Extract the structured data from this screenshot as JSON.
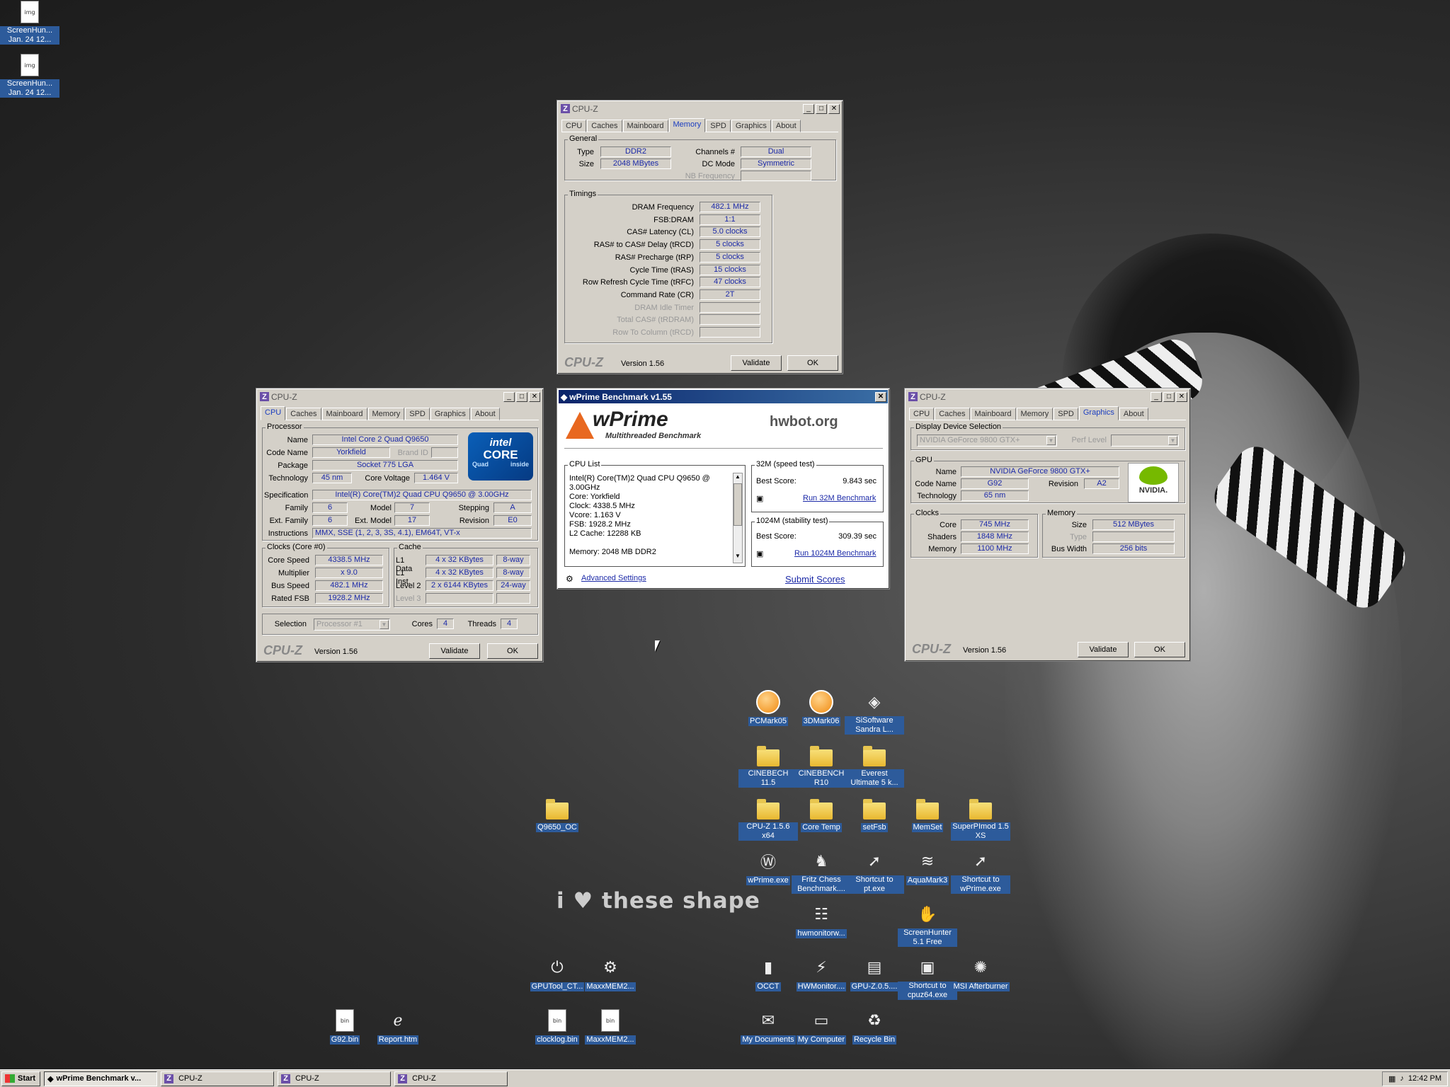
{
  "desktop": {
    "wallpaper_text": "i ♥ these shape",
    "icons": [
      {
        "label": "ScreenHun... Jan. 24 12...",
        "icon": "image-file-icon"
      },
      {
        "label": "ScreenHun... Jan. 24 12...",
        "icon": "image-file-icon"
      },
      {
        "label": "PCMark05",
        "icon": "pcmark-icon"
      },
      {
        "label": "3DMark06",
        "icon": "3dmark-icon"
      },
      {
        "label": "SiSoftware Sandra L...",
        "icon": "sandra-icon"
      },
      {
        "label": "CINEBECH 11.5",
        "icon": "folder-icon"
      },
      {
        "label": "CINEBENCH R10",
        "icon": "folder-icon"
      },
      {
        "label": "Everest Ultimate 5 k...",
        "icon": "folder-icon"
      },
      {
        "label": "Q9650_OC",
        "icon": "folder-icon"
      },
      {
        "label": "CPU-Z 1.5.6 x64",
        "icon": "folder-icon"
      },
      {
        "label": "Core Temp",
        "icon": "folder-icon"
      },
      {
        "label": "setFsb",
        "icon": "folder-icon"
      },
      {
        "label": "MemSet",
        "icon": "folder-icon"
      },
      {
        "label": "SuperPImod 1.5 XS",
        "icon": "folder-icon"
      },
      {
        "label": "wPrime.exe",
        "icon": "wprime-icon"
      },
      {
        "label": "Fritz Chess Benchmark....",
        "icon": "fritz-icon"
      },
      {
        "label": "Shortcut to pt.exe",
        "icon": "shortcut-icon"
      },
      {
        "label": "AquaMark3",
        "icon": "aquamark-icon"
      },
      {
        "label": "Shortcut to wPrime.exe",
        "icon": "shortcut-icon"
      },
      {
        "label": "hwmonitorw...",
        "icon": "hwmonitor-icon"
      },
      {
        "label": "ScreenHunter 5.1 Free",
        "icon": "screenhunter-icon"
      },
      {
        "label": "GPUTool_CT...",
        "icon": "power-icon"
      },
      {
        "label": "MaxxMEM2...",
        "icon": "gear-icon"
      },
      {
        "label": "OCCT",
        "icon": "occt-icon"
      },
      {
        "label": "HWMonitor....",
        "icon": "hwmonitor-bolt-icon"
      },
      {
        "label": "GPU-Z.0.5....",
        "icon": "gpuz-icon"
      },
      {
        "label": "Shortcut to cpuz64.exe",
        "icon": "cpuz-icon"
      },
      {
        "label": "MSI Afterburner",
        "icon": "afterburner-icon"
      },
      {
        "label": "G92.bin",
        "icon": "file-icon"
      },
      {
        "label": "Report.htm",
        "icon": "ie-icon"
      },
      {
        "label": "clocklog.bin",
        "icon": "file-icon"
      },
      {
        "label": "MaxxMEM2...",
        "icon": "file-icon"
      },
      {
        "label": "My Documents",
        "icon": "my-documents-icon"
      },
      {
        "label": "My Computer",
        "icon": "my-computer-icon"
      },
      {
        "label": "Recycle Bin",
        "icon": "recycle-bin-icon"
      }
    ]
  },
  "common": {
    "title": "CPU-Z",
    "version": "Version 1.56",
    "brand": "CPU-Z",
    "validate": "Validate",
    "ok": "OK",
    "tabs": [
      "CPU",
      "Caches",
      "Mainboard",
      "Memory",
      "SPD",
      "Graphics",
      "About"
    ]
  },
  "memory_window": {
    "general_label": "General",
    "type_label": "Type",
    "type": "DDR2",
    "size_label": "Size",
    "size": "2048 MBytes",
    "channels_label": "Channels #",
    "channels": "Dual",
    "dcmode_label": "DC Mode",
    "dcmode": "Symmetric",
    "nbfreq_label": "NB Frequency",
    "timings_label": "Timings",
    "timings": [
      {
        "label": "DRAM Frequency",
        "value": "482.1 MHz"
      },
      {
        "label": "FSB:DRAM",
        "value": "1:1"
      },
      {
        "label": "CAS# Latency (CL)",
        "value": "5.0 clocks"
      },
      {
        "label": "RAS# to CAS# Delay (tRCD)",
        "value": "5 clocks"
      },
      {
        "label": "RAS# Precharge (tRP)",
        "value": "5 clocks"
      },
      {
        "label": "Cycle Time (tRAS)",
        "value": "15 clocks"
      },
      {
        "label": "Row Refresh Cycle Time (tRFC)",
        "value": "47 clocks"
      },
      {
        "label": "Command Rate (CR)",
        "value": "2T"
      },
      {
        "label": "DRAM Idle Timer",
        "value": ""
      },
      {
        "label": "Total CAS# (tRDRAM)",
        "value": ""
      },
      {
        "label": "Row To Column (tRCD)",
        "value": ""
      }
    ]
  },
  "cpu_window": {
    "processor_label": "Processor",
    "name_label": "Name",
    "name": "Intel Core 2 Quad Q9650",
    "codename_label": "Code Name",
    "codename": "Yorkfield",
    "brandid_label": "Brand ID",
    "package_label": "Package",
    "package": "Socket 775 LGA",
    "technology_label": "Technology",
    "technology": "45 nm",
    "corevoltage_label": "Core Voltage",
    "corevoltage": "1.464 V",
    "spec_label": "Specification",
    "spec": "Intel(R) Core(TM)2 Quad CPU    Q9650  @ 3.00GHz",
    "family_label": "Family",
    "family": "6",
    "model_label": "Model",
    "model": "7",
    "stepping_label": "Stepping",
    "stepping": "A",
    "extfamily_label": "Ext. Family",
    "extfamily": "6",
    "extmodel_label": "Ext. Model",
    "extmodel": "17",
    "revision_label": "Revision",
    "revision": "E0",
    "instructions_label": "Instructions",
    "instructions": "MMX, SSE (1, 2, 3, 3S, 4.1), EM64T, VT-x",
    "clocks_label": "Clocks (Core #0)",
    "corespeed_label": "Core Speed",
    "corespeed": "4338.5 MHz",
    "multiplier_label": "Multiplier",
    "multiplier": "x 9.0",
    "busspeed_label": "Bus Speed",
    "busspeed": "482.1 MHz",
    "ratedfsb_label": "Rated FSB",
    "ratedfsb": "1928.2 MHz",
    "cache_label": "Cache",
    "l1data_label": "L1 Data",
    "l1data": "4 x 32 KBytes",
    "l1data_way": "8-way",
    "l1inst_label": "L1 Inst.",
    "l1inst": "4 x 32 KBytes",
    "l1inst_way": "8-way",
    "level2_label": "Level 2",
    "level2": "2 x 6144 KBytes",
    "level2_way": "24-way",
    "level3_label": "Level 3",
    "selection_label": "Selection",
    "selection": "Processor #1",
    "cores_label": "Cores",
    "cores": "4",
    "threads_label": "Threads",
    "threads": "4",
    "intel_logo": {
      "brand": "intel",
      "line": "CORE",
      "sub": "Quad",
      "inside": "inside"
    }
  },
  "graphics_window": {
    "display_label": "Display Device Selection",
    "device": "NVIDIA GeForce 9800 GTX+",
    "perf_label": "Perf Level",
    "gpu_label": "GPU",
    "name_label": "Name",
    "name": "NVIDIA GeForce 9800 GTX+",
    "codename_label": "Code Name",
    "codename": "G92",
    "revision_label": "Revision",
    "revision": "A2",
    "technology_label": "Technology",
    "technology": "65 nm",
    "clocks_label": "Clocks",
    "core_label": "Core",
    "core": "745 MHz",
    "shaders_label": "Shaders",
    "shaders": "1848 MHz",
    "memory_label": "Memory",
    "memory": "1100 MHz",
    "mem_group_label": "Memory",
    "size_label": "Size",
    "size": "512 MBytes",
    "type_label": "Type",
    "buswidth_label": "Bus Width",
    "buswidth": "256 bits",
    "nvidia_logo": "NVIDIA."
  },
  "wprime": {
    "title": "wPrime Benchmark v1.55",
    "logo": "wPrime",
    "tagline": "Multithreaded Benchmark",
    "hwbot": "hwbot.org",
    "cpu_list_label": "CPU List",
    "cpu_list": [
      "Intel(R) Core(TM)2 Quad CPU    Q9650  @",
      "3.00GHz",
      "Core: Yorkfield",
      "Clock: 4338.5 MHz",
      "Vcore: 1.163 V",
      "FSB: 1928.2 MHz",
      "L2 Cache: 12288 KB",
      "",
      "Memory: 2048 MB DDR2"
    ],
    "t32_label": "32M (speed test)",
    "best_label": "Best Score:",
    "t32_score": "9.843 sec",
    "run32": "Run 32M Benchmark",
    "t1024_label": "1024M (stability test)",
    "t1024_score": "309.39 sec",
    "run1024": "Run 1024M Benchmark",
    "advanced": "Advanced Settings",
    "submit": "Submit Scores"
  },
  "taskbar": {
    "start": "Start",
    "items": [
      "wPrime Benchmark v...",
      "CPU-Z",
      "CPU-Z",
      "CPU-Z"
    ],
    "clock": "12:42 PM"
  }
}
